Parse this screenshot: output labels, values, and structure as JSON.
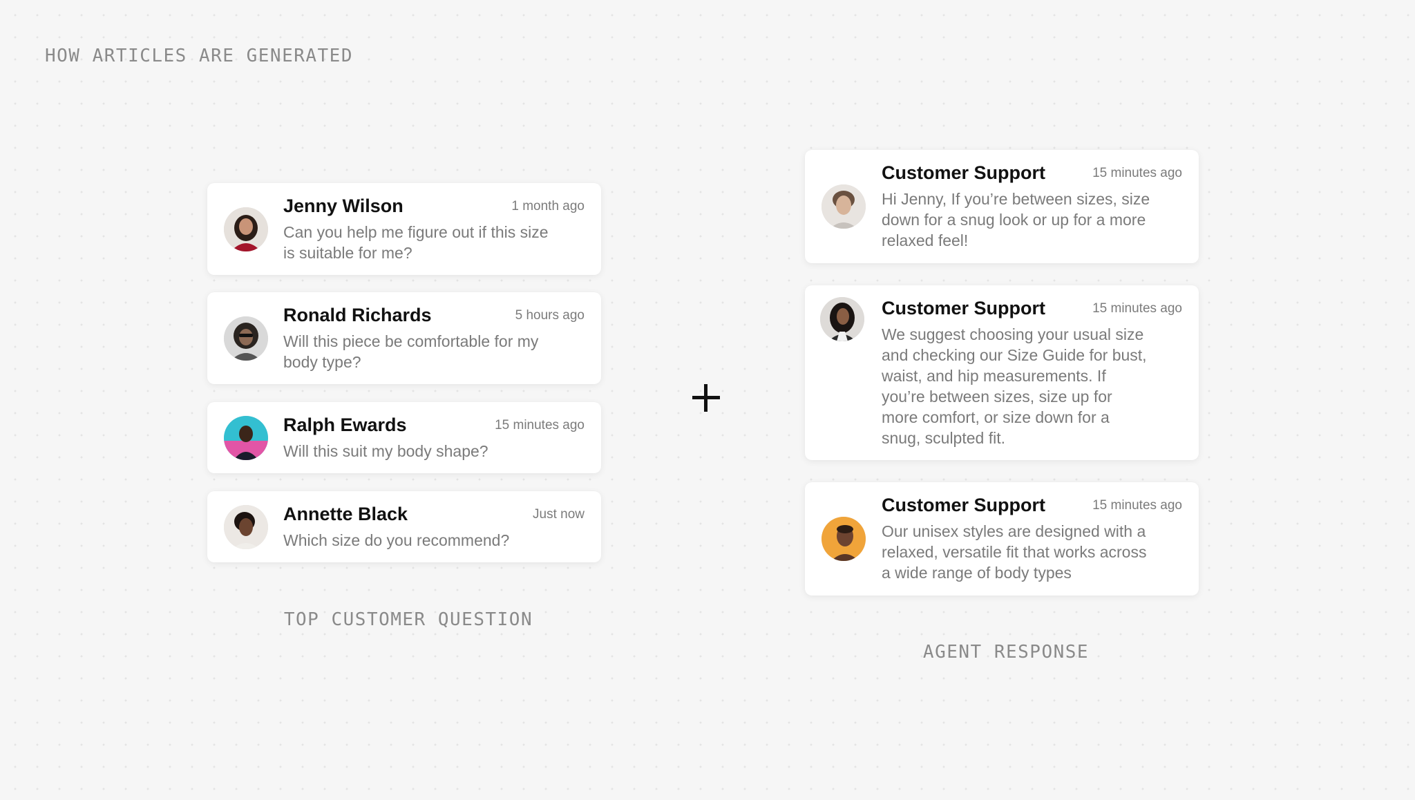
{
  "header": {
    "title": "HOW ARTICLES ARE GENERATED"
  },
  "questions": {
    "label": "TOP CUSTOMER QUESTION",
    "items": [
      {
        "name": "Jenny Wilson",
        "time": "1 month ago",
        "lines": [
          "Can you help me figure out if this size",
          "is suitable for me?"
        ],
        "avatar": "avatar-jenny-wilson"
      },
      {
        "name": "Ronald Richards",
        "time": "5 hours ago",
        "lines": [
          "Will this piece be comfortable for my",
          "body type?"
        ],
        "avatar": "avatar-ronald-richards"
      },
      {
        "name": "Ralph Ewards",
        "time": "15 minutes ago",
        "lines": [
          "Will this suit my body shape?"
        ],
        "avatar": "avatar-ralph-ewards"
      },
      {
        "name": "Annette Black",
        "time": "Just now",
        "lines": [
          "Which size do you recommend?"
        ],
        "avatar": "avatar-annette-black"
      }
    ]
  },
  "operator": {
    "symbol": "plus-icon"
  },
  "responses": {
    "label": "AGENT RESPONSE",
    "items": [
      {
        "name": "Customer Support",
        "time": "15 minutes ago",
        "lines": [
          "Hi Jenny, If you’re between sizes, size",
          "down for a snug look or up for a more",
          "relaxed feel!"
        ],
        "avatar": "avatar-support-agent-1"
      },
      {
        "name": "Customer Support",
        "time": "15 minutes ago",
        "lines": [
          "We suggest choosing your usual size",
          "and checking our Size Guide for bust,",
          "waist, and hip measurements. If",
          "you’re between sizes, size up for",
          "more comfort, or size down for a",
          "snug, sculpted fit."
        ],
        "avatar": "avatar-support-agent-2"
      },
      {
        "name": "Customer Support",
        "time": "15 minutes ago",
        "lines": [
          "Our unisex styles are designed with a",
          "relaxed, versatile fit that works across",
          "a wide range of body types"
        ],
        "avatar": "avatar-support-agent-3"
      }
    ]
  },
  "colors": {
    "background": "#f6f6f6",
    "card": "#ffffff",
    "name": "#111111",
    "message": "#7a7a7a",
    "label": "#8a8a8a"
  }
}
